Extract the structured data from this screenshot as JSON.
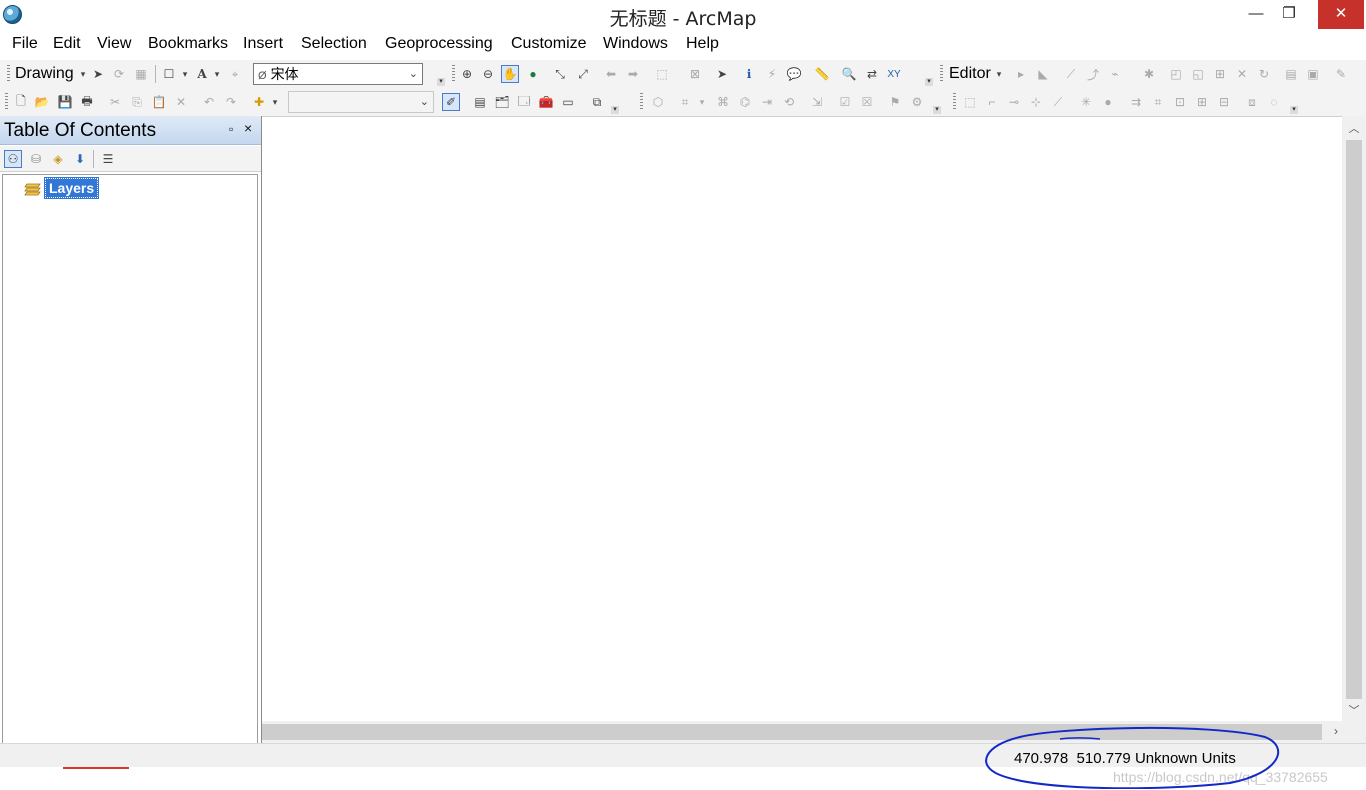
{
  "window": {
    "title": "无标题 - ArcMap",
    "controls": {
      "minimize": "—",
      "maximize": "❐",
      "close": "✕"
    }
  },
  "menu": [
    "File",
    "Edit",
    "View",
    "Bookmarks",
    "Insert",
    "Selection",
    "Geoprocessing",
    "Customize",
    "Windows",
    "Help"
  ],
  "drawing_toolbar": {
    "label": "Drawing",
    "font_dropdown": {
      "value": "宋体"
    }
  },
  "editor_toolbar": {
    "label": "Editor"
  },
  "toc": {
    "title": "Table Of Contents",
    "root_label": "Layers"
  },
  "status": {
    "coordinates": "470.978  510.779 Unknown Units"
  },
  "watermark": "https://blog.csdn.net/qq_33782655",
  "annotation": {
    "color": "#1428c8",
    "shape": "hand-drawn ellipse"
  },
  "colors": {
    "toc_header": "#c4d7ee",
    "selection_highlight": "#3178d6",
    "close_button": "#c7312b"
  }
}
